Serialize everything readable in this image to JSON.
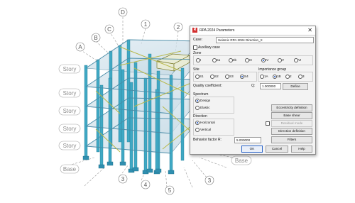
{
  "model": {
    "story_labels": [
      "Story",
      "Story",
      "Story",
      "Story",
      "Story"
    ],
    "base_label": "Base",
    "grid_labels": [
      "A",
      "B",
      "C",
      "D",
      "1",
      "2",
      "3",
      "3",
      "4",
      "5"
    ],
    "colors": {
      "column": "#3fa8c4",
      "beam": "#4a8da8",
      "brace": "#b8b84a",
      "floor": "#c8dbe6"
    }
  },
  "dialog": {
    "title": "RPA 2024 Parameters",
    "app_icon_letter": "R",
    "close_glyph": "✕",
    "case_label": "Case:",
    "case_value": "Seismic RPA 2024  Direction_X",
    "auxiliary_label": "Auxiliary case",
    "zone_label": "Zone",
    "zones": [
      "I",
      "IIa",
      "IIb",
      "III",
      "IV",
      "V",
      "VI"
    ],
    "zone_selected": "IV",
    "site_label": "Site",
    "sites": [
      "S1",
      "S2",
      "S3",
      "S4"
    ],
    "site_selected": "S4",
    "importance_label": "Importance group",
    "importance": [
      "1A",
      "1B",
      "2",
      "3"
    ],
    "importance_selected": "1B",
    "quality_label": "Quality coefficient:",
    "q_label": "Q:",
    "q_value": "1.000000",
    "define_label": "Define",
    "spectrum_label": "Spectrum",
    "spectrum_options": [
      "Design",
      "Elastic"
    ],
    "spectrum_selected": "Design",
    "direction_label": "Direction",
    "direction_options": [
      "Horizontal",
      "Vertical"
    ],
    "direction_selected": "Horizontal",
    "eccentricity_label": "Eccentricity definition",
    "base_shear_label": "Base shear",
    "residual_mode_label": "Residual mode",
    "direction_def_label": "Direction definition",
    "behavior_label": "Behavior factor R:",
    "behavior_value": "5.000000",
    "filters_label": "Filters",
    "ok_label": "OK",
    "cancel_label": "Cancel",
    "help_label": "Help"
  }
}
